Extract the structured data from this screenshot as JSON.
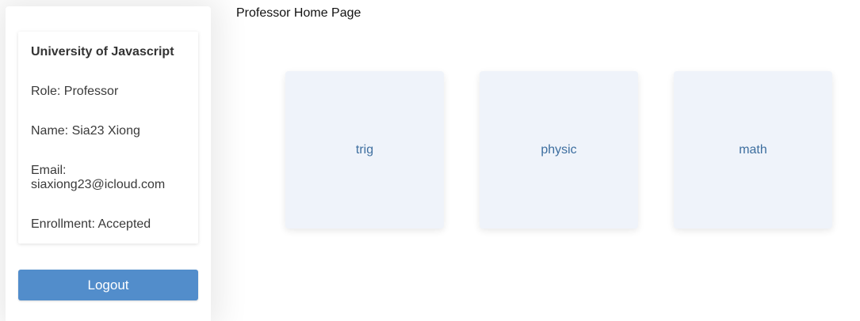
{
  "page": {
    "title": "Professor Home Page"
  },
  "profile": {
    "university": "University of Javascript",
    "role": "Role: Professor",
    "name": "Name: Sia23 Xiong",
    "email_label": "Email:",
    "email_value": "siaxiong23@icloud.com",
    "enrollment": "Enrollment: Accepted"
  },
  "logout_label": "Logout",
  "courses": [
    {
      "label": "trig"
    },
    {
      "label": "physic"
    },
    {
      "label": "math"
    }
  ],
  "colors": {
    "logout_button": "#528dcb",
    "course_card_bg": "#eff3fa",
    "course_label": "#3d6e9f"
  }
}
